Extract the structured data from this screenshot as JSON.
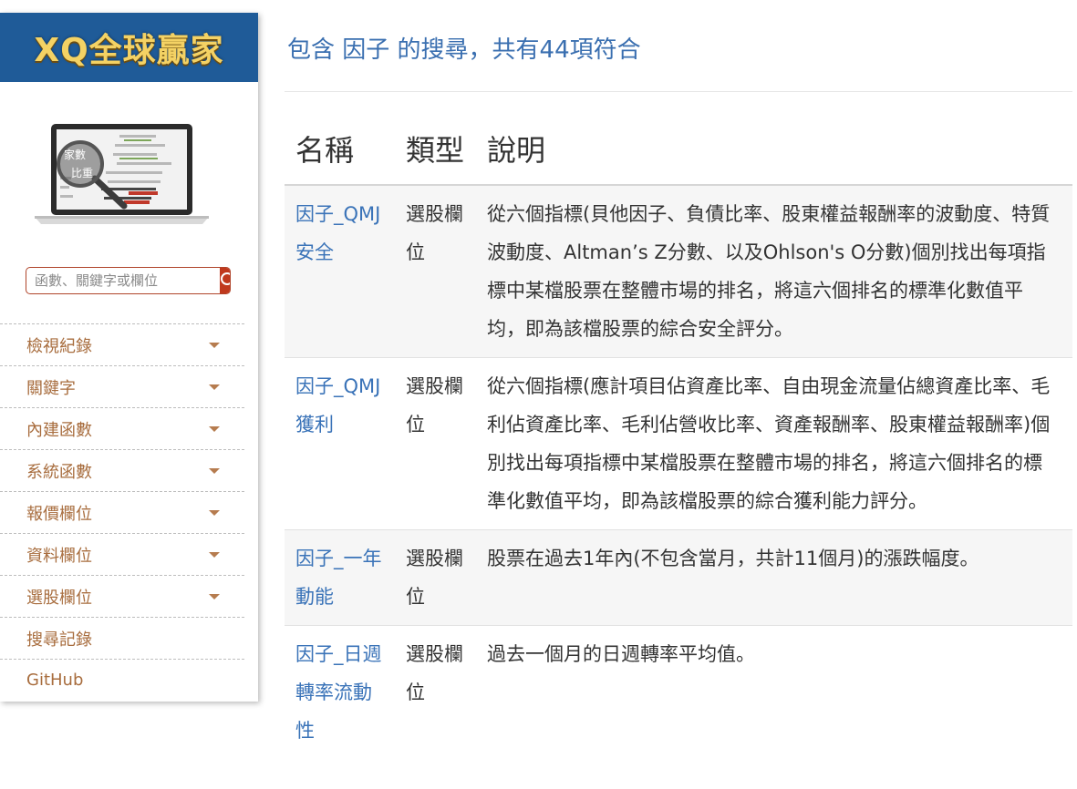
{
  "sidebar": {
    "logo_text": "XQ全球贏家",
    "laptop_screen_text": [
      "家數",
      "比重"
    ],
    "search": {
      "placeholder": "函數、關鍵字或欄位",
      "icon": "search-icon"
    },
    "nav_items": [
      {
        "label": "檢視紀錄",
        "has_dropdown": true
      },
      {
        "label": "關鍵字",
        "has_dropdown": true
      },
      {
        "label": "內建函數",
        "has_dropdown": true
      },
      {
        "label": "系統函數",
        "has_dropdown": true
      },
      {
        "label": "報價欄位",
        "has_dropdown": true
      },
      {
        "label": "資料欄位",
        "has_dropdown": true
      },
      {
        "label": "選股欄位",
        "has_dropdown": true
      },
      {
        "label": "搜尋記錄",
        "has_dropdown": false
      },
      {
        "label": "GitHub",
        "has_dropdown": false
      }
    ]
  },
  "main": {
    "heading": "包含 因子 的搜尋，共有44項符合",
    "table": {
      "headers": [
        "名稱",
        "類型",
        "說明"
      ],
      "rows": [
        {
          "name": "因子_QMJ安全",
          "type": "選股欄位",
          "description": "從六個指標(貝他因子、負債比率、股東權益報酬率的波動度、特質波動度、Altman’s Z分數、以及Ohlson's O分數)個別找出每項指標中某檔股票在整體市場的排名，將這六個排名的標準化數值平均，即為該檔股票的綜合安全評分。"
        },
        {
          "name": "因子_QMJ獲利",
          "type": "選股欄位",
          "description": "從六個指標(應計項目佔資產比率、自由現金流量佔總資產比率、毛利佔資產比率、毛利佔營收比率、資產報酬率、股東權益報酬率)個別找出每項指標中某檔股票在整體市場的排名，將這六個排名的標準化數值平均，即為該檔股票的綜合獲利能力評分。"
        },
        {
          "name": "因子_一年動能",
          "type": "選股欄位",
          "description": "股票在過去1年內(不包含當月，共計11個月)的漲跌幅度。"
        },
        {
          "name": "因子_日週轉率流動性",
          "type": "選股欄位",
          "description": "過去一個月的日週轉率平均值。"
        }
      ]
    }
  },
  "colors": {
    "logo_banner": "#1f5b98",
    "logo_text": "#f4d264",
    "link": "#3a73b8",
    "nav_text": "#a86d3e",
    "search_button": "#c0391d"
  }
}
